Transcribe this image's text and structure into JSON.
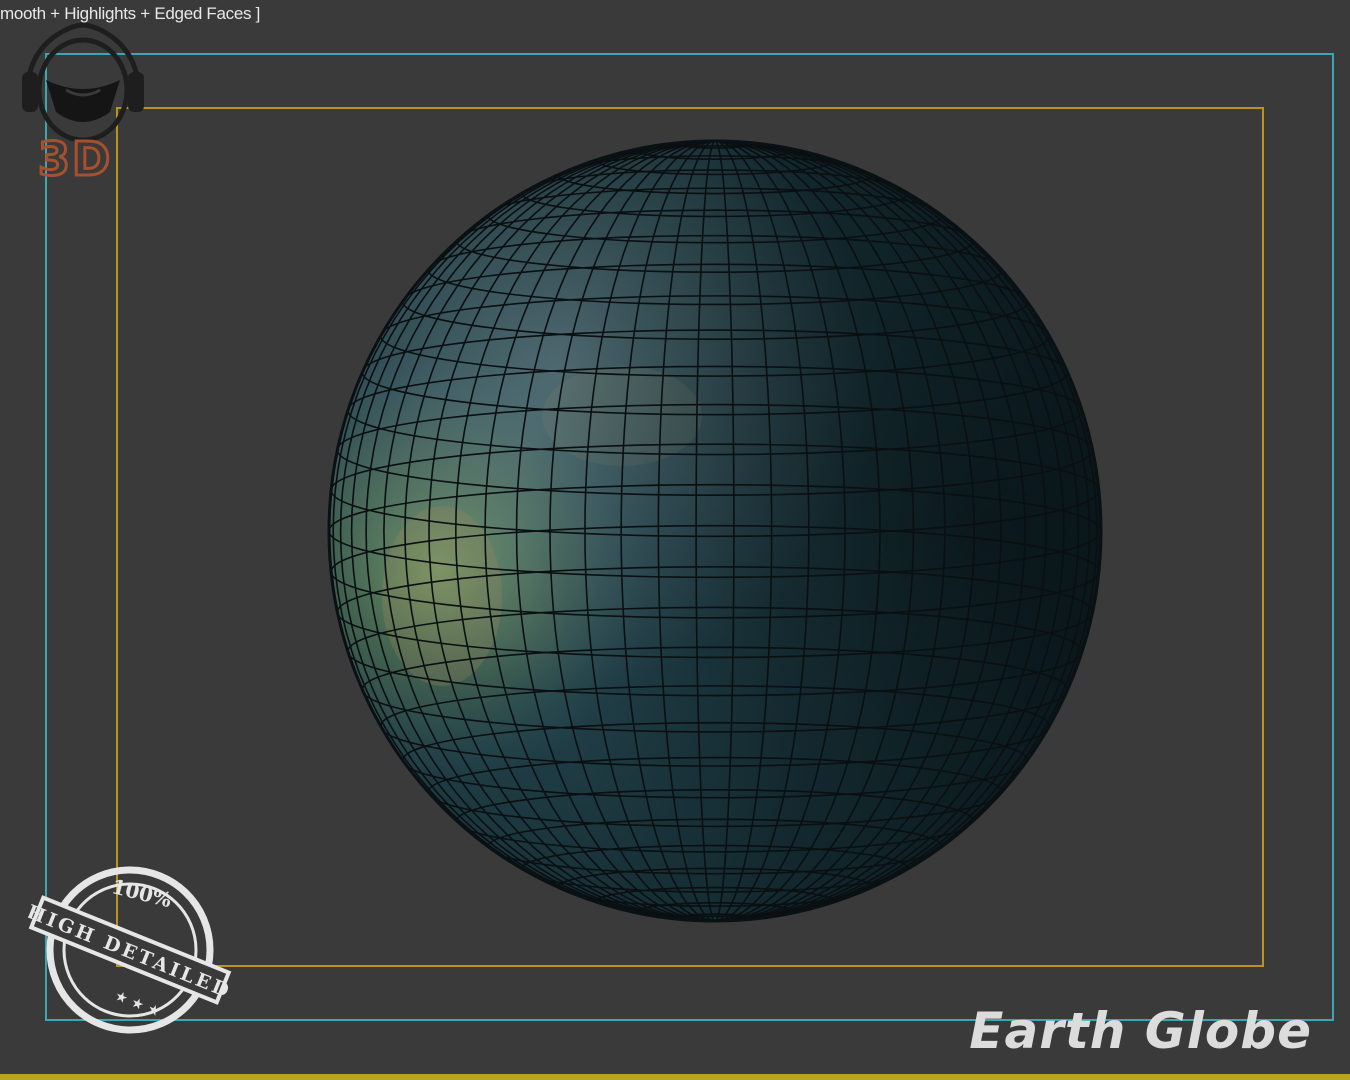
{
  "viewport": {
    "label": "mooth + Highlights + Edged Faces ]",
    "background": "#3a3a3a",
    "safe_frame_color": "#3aa7b2",
    "action_frame_color": "#b8941e"
  },
  "logo": {
    "icon": "headphones-helmet-icon",
    "text": "3D",
    "color": "#a8502e"
  },
  "stamp": {
    "percent": "100%",
    "label": "HIGH DETAILED",
    "color": "#e6e6e6"
  },
  "model": {
    "name": "Earth Globe",
    "object": "sphere-mesh",
    "colors": {
      "ocean": "#1a3a42",
      "land": "#6a8a5a",
      "wire": "#0a0f12"
    }
  }
}
